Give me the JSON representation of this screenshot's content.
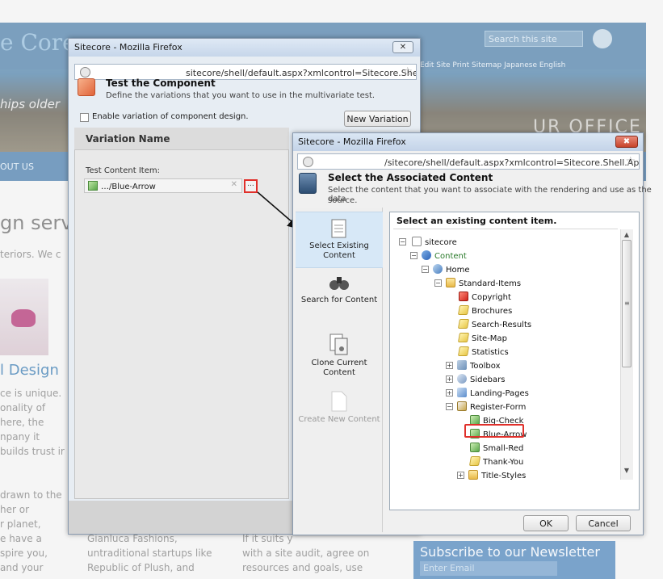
{
  "background": {
    "logo": "e Core",
    "tagline": "hips older",
    "search_placeholder": "Search this site",
    "toplinks": "Edit Site   Print   Sitemap   Japanese   English",
    "office": "UR OFFICE",
    "nav_item": "OUT US",
    "heading1": "gn servic",
    "line1": "teriors. We c",
    "heading2": "l Design",
    "para1": [
      "ce is unique.",
      "onality of",
      "here, the",
      "npany it",
      "builds trust ir"
    ],
    "para2": [
      "drawn to the",
      "her or",
      "r planet,",
      "e have a",
      "spire you,",
      "and your"
    ],
    "col2": [
      "Gianluca Fashions,",
      "untraditional startups like",
      "Republic of Plush, and"
    ],
    "col3": [
      "If it suits y",
      "with a site audit, agree on",
      "resources and goals, use"
    ],
    "newsletter_title": "Subscribe to our Newsletter",
    "newsletter_placeholder": "Enter Email"
  },
  "dialog1": {
    "window_title": "Sitecore - Mozilla Firefox",
    "close_label": "✕",
    "url": "sitecore/shell/default.aspx?xmlcontrol=Sitecore.Shell.Applicá",
    "title": "Test the Component",
    "subtitle": "Define the variations that you want to use in the multivariate test.",
    "checkbox_label": "Enable variation of component design.",
    "new_variation_label": "New Variation",
    "column_header": "Variation Name",
    "field_label": "Test Content Item:",
    "field_value": "…/Blue-Arrow",
    "clear_label": "✕",
    "browse_label": "..."
  },
  "dialog2": {
    "window_title": "Sitecore - Mozilla Firefox",
    "close_label": "✖",
    "url": "/sitecore/shell/default.aspx?xmlcontrol=Sitecore.Shell.Applicat",
    "title": "Select the Associated Content",
    "subtitle1": "Select the content that you want to associate with the rendering and use as the data",
    "subtitle2": "source.",
    "options": [
      {
        "line1": "Select Existing",
        "line2": "Content"
      },
      {
        "line1": "Search for Content",
        "line2": ""
      },
      {
        "line1": "Clone Current",
        "line2": "Content"
      },
      {
        "line1": "Create New Content",
        "line2": ""
      }
    ],
    "tree_heading": "Select an existing content item.",
    "tree": [
      {
        "label": "sitecore",
        "exp": "⊟",
        "icon": "doc"
      },
      {
        "label": "Content",
        "exp": "⊟",
        "icon": "content"
      },
      {
        "label": "Home",
        "exp": "⊟",
        "icon": "home"
      },
      {
        "label": "Standard-Items",
        "exp": "⊟",
        "icon": "folder"
      },
      {
        "label": "Copyright",
        "exp": "",
        "icon": "red"
      },
      {
        "label": "Brochures",
        "exp": "",
        "icon": "yellow"
      },
      {
        "label": "Search-Results",
        "exp": "",
        "icon": "yellow"
      },
      {
        "label": "Site-Map",
        "exp": "",
        "icon": "yellow"
      },
      {
        "label": "Statistics",
        "exp": "",
        "icon": "yellow"
      },
      {
        "label": "Toolbox",
        "exp": "⊞",
        "icon": "tool"
      },
      {
        "label": "Sidebars",
        "exp": "⊞",
        "icon": "side"
      },
      {
        "label": "Landing-Pages",
        "exp": "⊞",
        "icon": "land"
      },
      {
        "label": "Register-Form",
        "exp": "⊟",
        "icon": "form"
      },
      {
        "label": "Big-Check",
        "exp": "",
        "icon": "green"
      },
      {
        "label": "Blue-Arrow",
        "exp": "",
        "icon": "green"
      },
      {
        "label": "Small-Red",
        "exp": "",
        "icon": "green"
      },
      {
        "label": "Thank-You",
        "exp": "",
        "icon": "yellow"
      },
      {
        "label": "Title-Styles",
        "exp": "⊞",
        "icon": "folder"
      }
    ],
    "ok_label": "OK",
    "cancel_label": "Cancel",
    "selected_item": "Blue-Arrow"
  },
  "colors": {
    "highlight": "#e0302b",
    "accent": "#4a86b8"
  }
}
